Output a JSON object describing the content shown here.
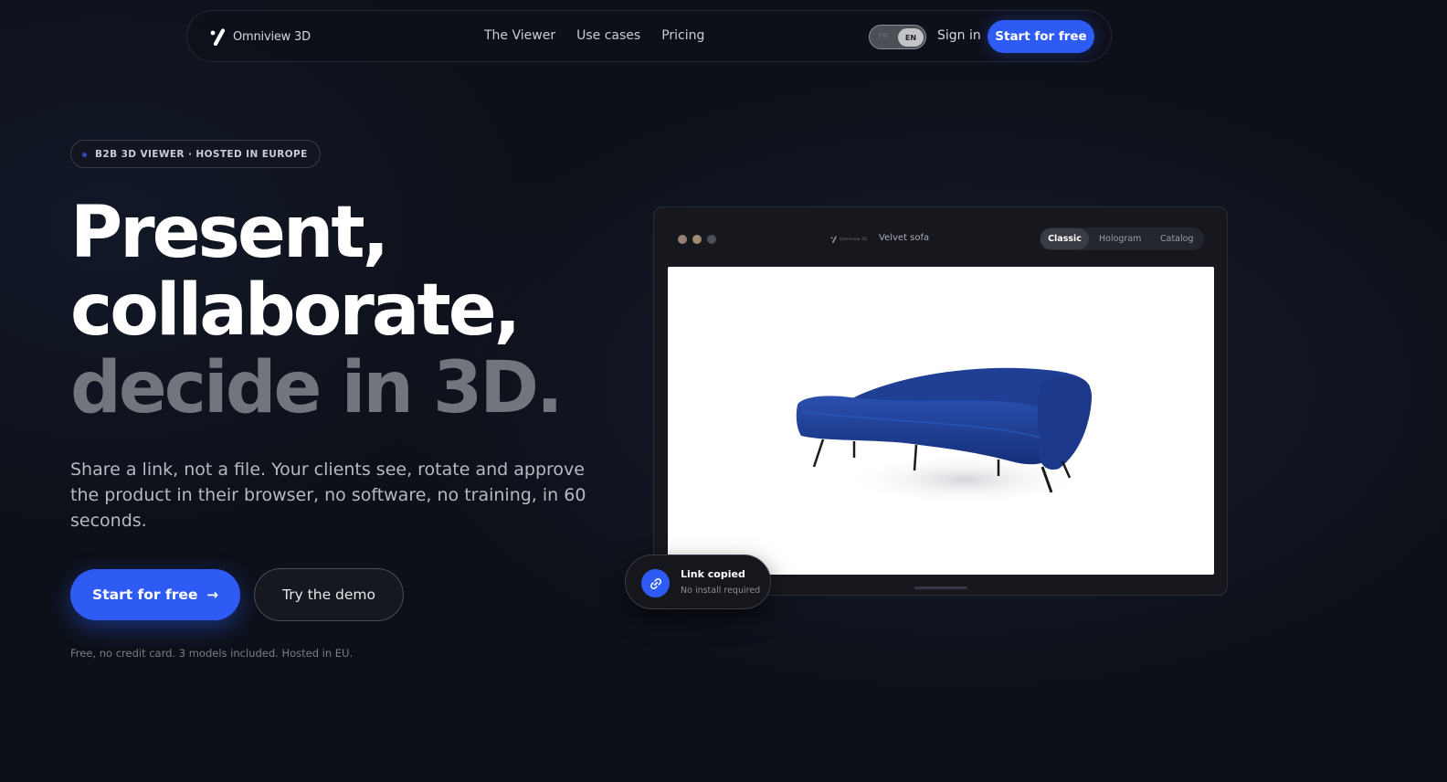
{
  "nav": {
    "brand": "Omniview 3D",
    "links": [
      "The Viewer",
      "Use cases",
      "Pricing"
    ],
    "lang_options": [
      "FR",
      "EN"
    ],
    "lang_selected": "EN",
    "sign_in": "Sign in",
    "cta": "Start for free"
  },
  "hero": {
    "badge": "B2B 3D VIEWER · HOSTED IN EUROPE",
    "headline": [
      "Present,",
      "collaborate,",
      "decide in 3D."
    ],
    "subtitle": "Share a link, not a file. Your clients see, rotate and approve the product in their browser, no software, no training, in 60 seconds.",
    "primary_cta": "Start for free",
    "secondary_cta": "Try the demo",
    "fineprint": "Free, no credit card. 3 models included. Hosted in EU."
  },
  "viewer": {
    "brand": "Omniview 3D",
    "title": "Velvet sofa",
    "tabs": [
      "Classic",
      "Hologram",
      "Catalog"
    ],
    "active_tab": "Classic"
  },
  "toast": {
    "title": "Link copied",
    "subtitle": "No install required"
  },
  "colors": {
    "background": "#0d1018",
    "accent": "#2f5bf5",
    "sofa": "#1f3f95"
  },
  "icons": {
    "brand": "omniview-logo-icon",
    "cta_arrow": "arrow-right-icon",
    "toast": "link-icon"
  }
}
